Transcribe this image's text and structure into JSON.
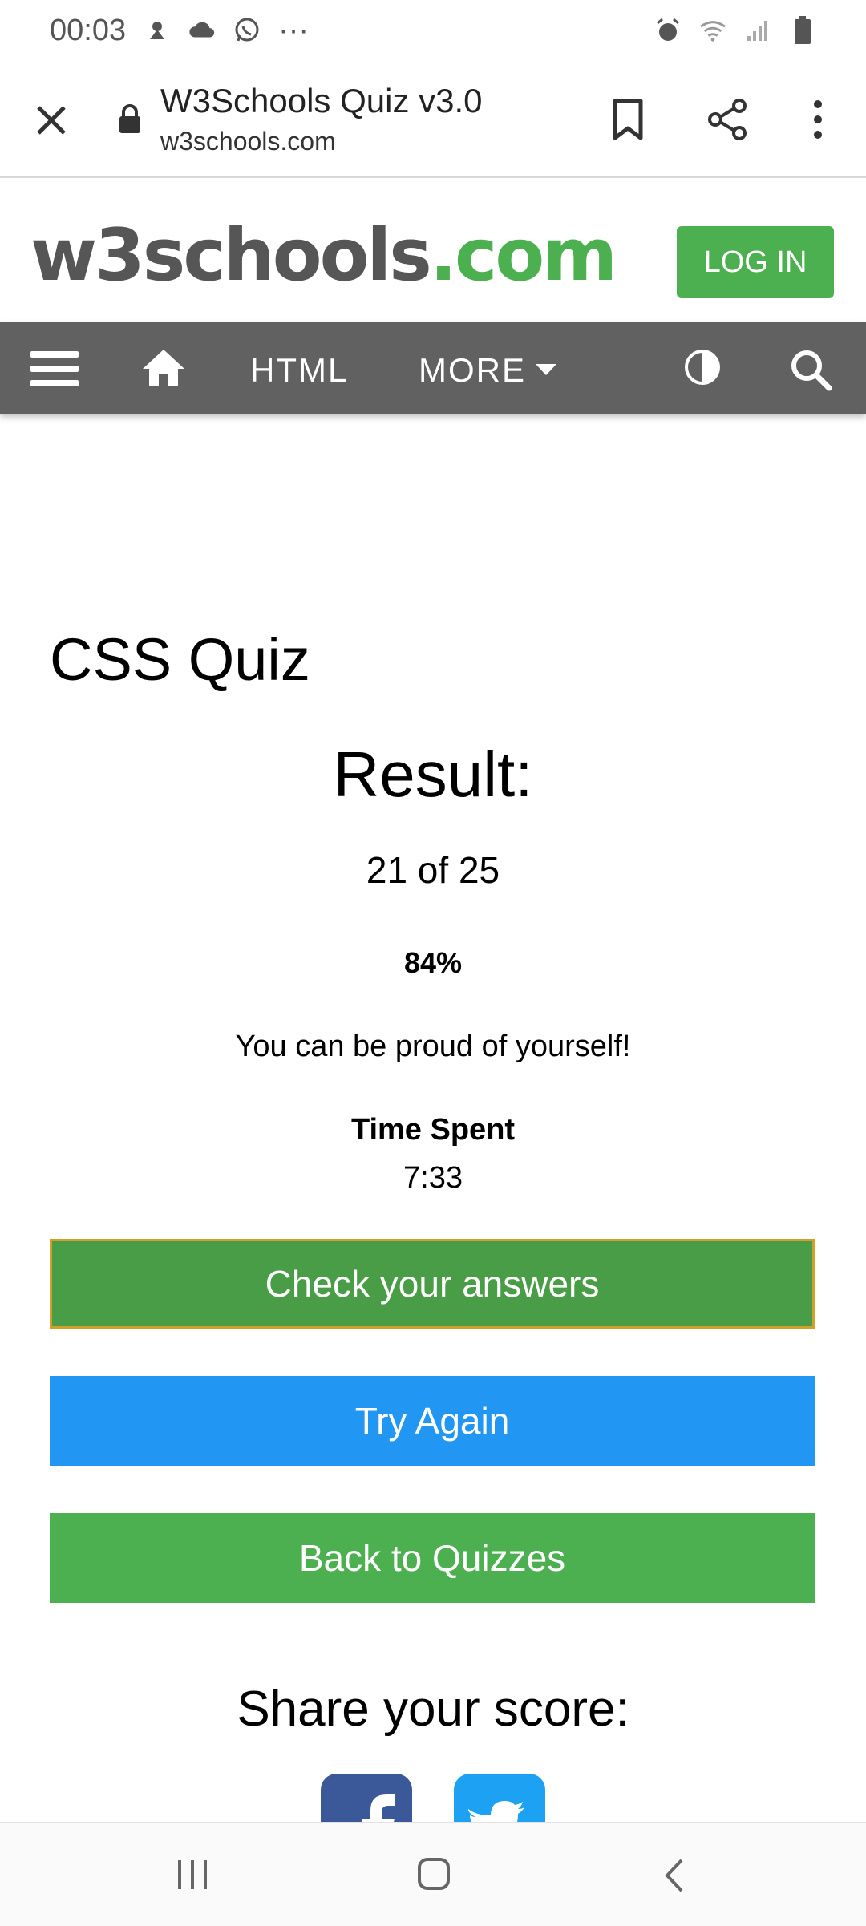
{
  "status_bar": {
    "time": "00:03",
    "icons": [
      "notification-icon",
      "cloud-icon",
      "whatsapp-icon",
      "more-dots-icon",
      "alarm-icon",
      "wifi-icon",
      "signal-icon",
      "battery-icon"
    ],
    "more": "···"
  },
  "browser": {
    "page_title": "W3Schools Quiz v3.0",
    "url": "w3schools.com"
  },
  "site": {
    "logo_dark": "w3schools",
    "logo_green": ".com",
    "login_label": "LOG IN"
  },
  "nav": {
    "html": "HTML",
    "more": "MORE"
  },
  "quiz": {
    "title": "CSS Quiz",
    "result_heading": "Result:",
    "score_text": "21 of 25",
    "percent_text": "84%",
    "message": "You can be proud of yourself!",
    "time_label": "Time Spent",
    "time_value": "7:33"
  },
  "buttons": {
    "check": "Check your answers",
    "try_again": "Try Again",
    "back": "Back to Quizzes"
  },
  "share": {
    "heading": "Share your score:"
  },
  "colors": {
    "green": "#4caf50",
    "blue": "#2196f3",
    "nav_gray": "#616161",
    "facebook": "#3b5998",
    "twitter": "#1da1f2"
  }
}
